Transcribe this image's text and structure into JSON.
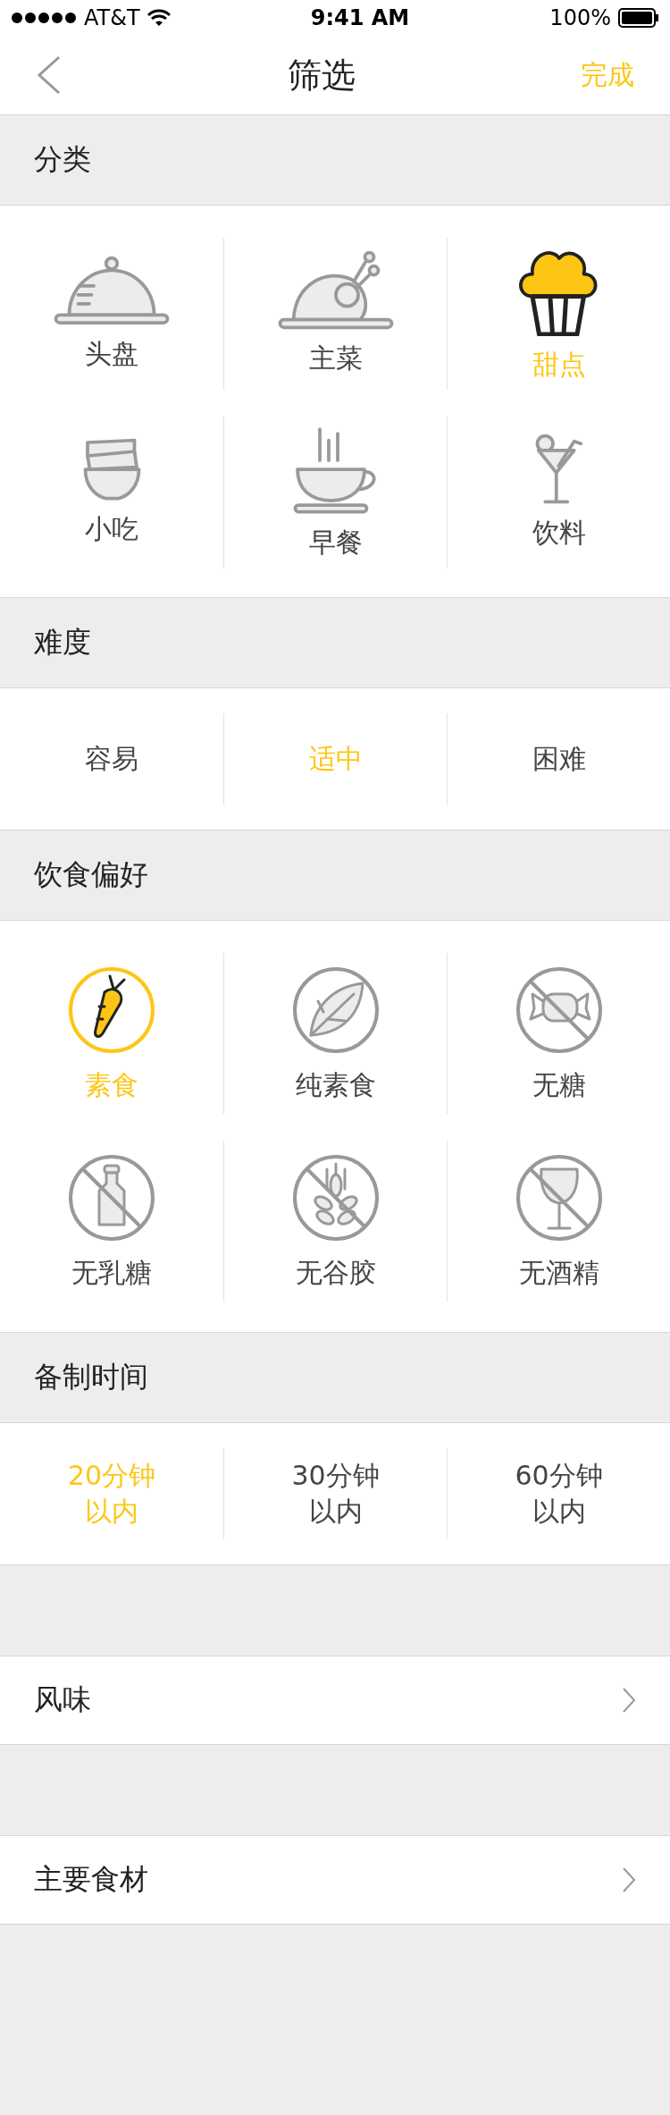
{
  "status_bar": {
    "carrier": "AT&T",
    "time": "9:41 AM",
    "battery": "100%"
  },
  "nav": {
    "title": "筛选",
    "action": "完成"
  },
  "category": {
    "title": "分类",
    "items": [
      {
        "label": "头盘",
        "kind": "cloche",
        "selected": false
      },
      {
        "label": "主菜",
        "kind": "chicken",
        "selected": false
      },
      {
        "label": "甜点",
        "kind": "muffin",
        "selected": true
      },
      {
        "label": "小吃",
        "kind": "bowls",
        "selected": false
      },
      {
        "label": "早餐",
        "kind": "cup",
        "selected": false
      },
      {
        "label": "饮料",
        "kind": "cocktail",
        "selected": false
      }
    ]
  },
  "difficulty": {
    "title": "难度",
    "items": [
      {
        "label": "容易",
        "selected": false
      },
      {
        "label": "适中",
        "selected": true
      },
      {
        "label": "困难",
        "selected": false
      }
    ]
  },
  "diet": {
    "title": "饮食偏好",
    "items": [
      {
        "label": "素食",
        "kind": "carrot",
        "selected": true
      },
      {
        "label": "纯素食",
        "kind": "leaf",
        "selected": false
      },
      {
        "label": "无糖",
        "kind": "candy",
        "selected": false
      },
      {
        "label": "无乳糖",
        "kind": "bottle",
        "selected": false
      },
      {
        "label": "无谷胶",
        "kind": "wheat",
        "selected": false
      },
      {
        "label": "无酒精",
        "kind": "wine",
        "selected": false
      }
    ]
  },
  "prep_time": {
    "title": "备制时间",
    "items": [
      {
        "lines": [
          "20分钟",
          "以内"
        ],
        "selected": true
      },
      {
        "lines": [
          "30分钟",
          "以内"
        ],
        "selected": false
      },
      {
        "lines": [
          "60分钟",
          "以内"
        ],
        "selected": false
      }
    ]
  },
  "links": [
    {
      "label": "风味"
    },
    {
      "label": "主要食材"
    }
  ]
}
